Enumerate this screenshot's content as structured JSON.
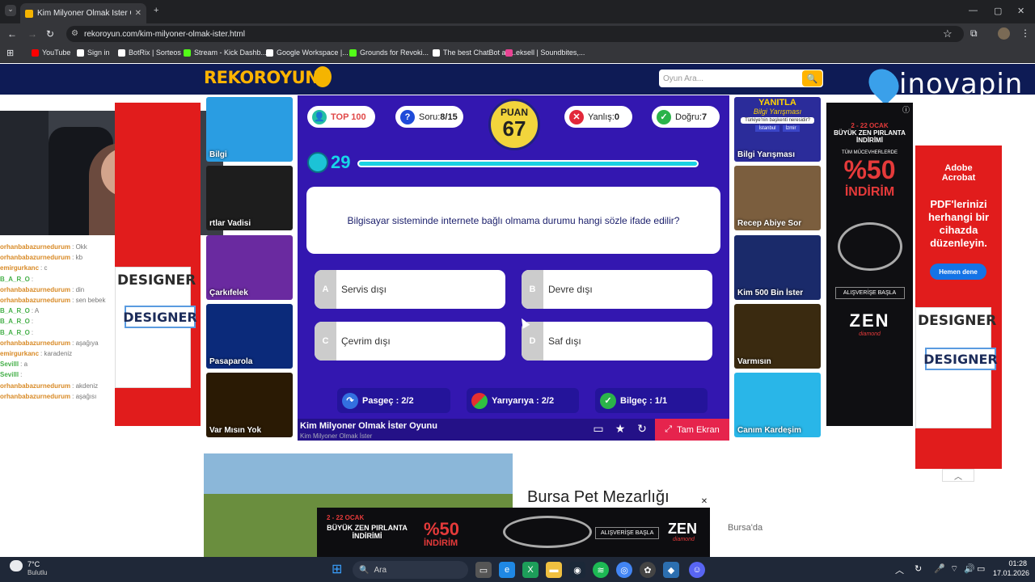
{
  "browser": {
    "tab_title": "Kim Milyoner Olmak İster Oyunu",
    "url": "rekoroyun.com/kim-milyoner-olmak-ister.html",
    "bookmarks": [
      {
        "label": "YouTube",
        "color": "#ff0000"
      },
      {
        "label": "Sign in",
        "color": "#ffffff"
      },
      {
        "label": "BotRix | Sorteos",
        "color": "#ffffff"
      },
      {
        "label": "Stream - Kick Dashb...",
        "color": "#53fc18"
      },
      {
        "label": "Google Workspace |...",
        "color": "#ffffff"
      },
      {
        "label": "Grounds for Revoki...",
        "color": "#53fc18"
      },
      {
        "label": "The best ChatBot an...",
        "color": "#ffffff"
      },
      {
        "label": "eksell | Soundbites,...",
        "color": "#e84393"
      }
    ]
  },
  "site": {
    "logo_text": "REKOROYUN",
    "search_placeholder": "Oyun Ara...",
    "ad_brand": "inovapin"
  },
  "game": {
    "top100_label": "TOP 100",
    "soru_label": "Soru:",
    "soru_value": "8/15",
    "puan_label": "PUAN",
    "puan_value": "67",
    "yanlis_label": "Yanlış:",
    "yanlis_value": "0",
    "dogru_label": "Doğru:",
    "dogru_value": "7",
    "timer": "29",
    "timer_fraction": 0.97,
    "question": "Bilgisayar sisteminde internete bağlı olmama durumu hangi sözle ifade edilir?",
    "answers": [
      {
        "letter": "A",
        "text": "Servis dışı"
      },
      {
        "letter": "B",
        "text": "Devre dışı"
      },
      {
        "letter": "C",
        "text": "Çevrim dışı"
      },
      {
        "letter": "D",
        "text": "Saf dışı"
      }
    ],
    "jokers": [
      {
        "label": "Pasgeç : 2/2"
      },
      {
        "label": "Yarıyarıya : 2/2"
      },
      {
        "label": "Bilgeç : 1/1"
      }
    ],
    "footer_title": "Kim Milyoner Olmak İster Oyunu",
    "footer_subtitle": "Kim Milyoner Olmak İster",
    "fullscreen_label": "Tam Ekran"
  },
  "left_games": [
    {
      "label": "Bilgi",
      "color": "#2a9de2"
    },
    {
      "label": "rtlar Vadisi",
      "color": "#1d1d1d"
    },
    {
      "label": "Çarkıfelek",
      "color": "#6a2aa0"
    },
    {
      "label": "Pasaparola",
      "color": "#0b2a7a"
    },
    {
      "label": "Var Mısın Yok",
      "color": "#2a1a04"
    }
  ],
  "right_games": [
    {
      "label": "Bilgi Yarışması",
      "color": "#2b2c9a"
    },
    {
      "label": "Recep Abiye Sor",
      "color": "#7b5e3e"
    },
    {
      "label": "Kim 500 Bin İster",
      "color": "#1a2a6a"
    },
    {
      "label": "Varmısın",
      "color": "#3a2a10"
    },
    {
      "label": "Canım Kardeşim",
      "color": "#29b6e8"
    }
  ],
  "bilgi_thumb": {
    "title": "YANITLA",
    "subtitle": "Bilgi Yarışması",
    "question": "Türkiye'nin başkenti neresidir?",
    "opt1": "İstanbul",
    "opt2": "İzmir"
  },
  "zen_ad": {
    "dates": "2 - 22 OCAK",
    "headline": "BÜYÜK ZEN PIRLANTA İNDİRİMİ",
    "sub": "TÜM MÜCEVHERLERDE",
    "discount": "%50",
    "discount_label": "İNDİRİM",
    "cta": "ALIŞVERİŞE BAŞLA",
    "brand": "ZEN",
    "brand_sub": "diamond"
  },
  "adobe_ad": {
    "brand": "Adobe Acrobat",
    "text": "PDF'lerinizi herhangi bir cihazda düzenleyin.",
    "cta": "Hemen dene"
  },
  "designer_ad": {
    "label": "DESIGNER"
  },
  "bottom_ad": {
    "title": "Bursa Pet Mezarlığı",
    "snippet": "Bursa'da"
  },
  "chat": [
    {
      "name": "orhanbabazurnedurum",
      "msg": ": Okk",
      "style": "cname"
    },
    {
      "name": "orhanbabazurnedurum",
      "msg": ": kb",
      "style": "cname"
    },
    {
      "name": "emirgurkanc",
      "msg": ": c",
      "style": "cname"
    },
    {
      "name": "B_A_R_O",
      "msg": ":",
      "style": "cname2"
    },
    {
      "name": "orhanbabazurnedurum",
      "msg": ": din",
      "style": "cname"
    },
    {
      "name": "orhanbabazurnedurum",
      "msg": ": sen bebek",
      "style": "cname"
    },
    {
      "name": "B_A_R_O",
      "msg": ": A",
      "style": "cname2"
    },
    {
      "name": "B_A_R_O",
      "msg": ":",
      "style": "cname2"
    },
    {
      "name": "B_A_R_O",
      "msg": ":",
      "style": "cname2"
    },
    {
      "name": "orhanbabazurnedurum",
      "msg": ": aşağıya",
      "style": "cname"
    },
    {
      "name": "emirgurkanc",
      "msg": ": karadeniz",
      "style": "cname"
    },
    {
      "name": "Sevilll",
      "msg": ": a",
      "style": "cname2"
    },
    {
      "name": "Sevilll",
      "msg": ":",
      "style": "cname2"
    },
    {
      "name": "orhanbabazurnedurum",
      "msg": ": akdeniz",
      "style": "cname"
    },
    {
      "name": "orhanbabazurnedurum",
      "msg": ": aşağısı",
      "style": "cname"
    }
  ],
  "taskbar": {
    "weather_temp": "7°C",
    "weather_desc": "Bulutlu",
    "search_label": "Ara",
    "time": "01:28",
    "date": "17.01.2026"
  }
}
